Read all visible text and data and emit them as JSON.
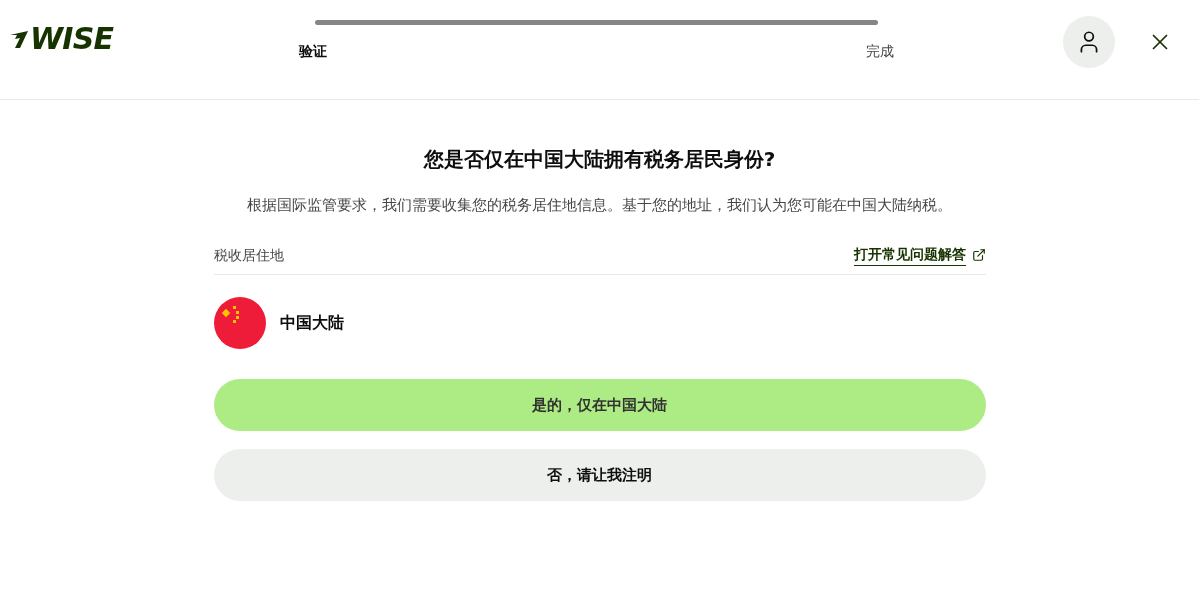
{
  "header": {
    "logo": "WISE",
    "steps": [
      {
        "label": "验证",
        "selected": true
      },
      {
        "label": "完成",
        "selected": false
      }
    ]
  },
  "title": "您是否仅在中国大陆拥有税务居民身份?",
  "description": "根据国际监管要求，我们需要收集您的税务居住地信息。基于您的地址，我们认为您可能在中国大陆纳税。",
  "section": {
    "label": "税收居住地",
    "link": "打开常见问题解答"
  },
  "country": {
    "name": "中国大陆"
  },
  "buttons": [
    {
      "label": "是的，仅在中国大陆",
      "kind": "primary"
    },
    {
      "label": "否，请让我注明",
      "kind": "secondary"
    }
  ]
}
